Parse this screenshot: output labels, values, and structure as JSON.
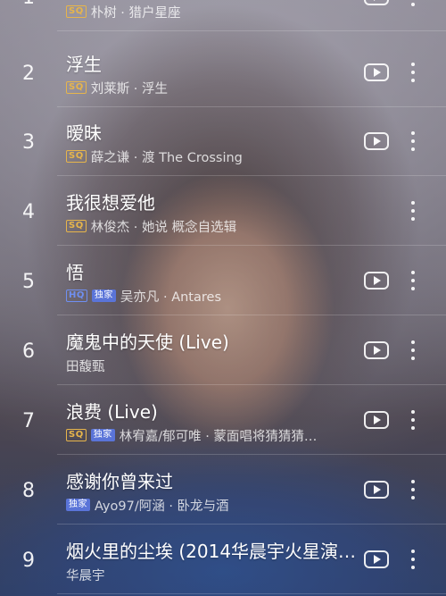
{
  "songs": [
    {
      "index": "1",
      "title": "",
      "badges": [
        "SQ"
      ],
      "subtitle": "朴树 · 猎户星座",
      "has_mv": true
    },
    {
      "index": "2",
      "title": "浮生",
      "badges": [
        "SQ"
      ],
      "subtitle": "刘莱斯 · 浮生",
      "has_mv": true
    },
    {
      "index": "3",
      "title": "暧昧",
      "badges": [
        "SQ"
      ],
      "subtitle": "薛之谦 · 渡 The Crossing",
      "has_mv": true
    },
    {
      "index": "4",
      "title": "我很想爱他",
      "badges": [
        "SQ"
      ],
      "subtitle": "林俊杰 · 她说 概念自选辑",
      "has_mv": false
    },
    {
      "index": "5",
      "title": "悟",
      "badges": [
        "HQ",
        "独家"
      ],
      "subtitle": "吴亦凡 · Antares",
      "has_mv": true
    },
    {
      "index": "6",
      "title": "魔鬼中的天使 (Live)",
      "badges": [],
      "subtitle": "田馥甄",
      "has_mv": true
    },
    {
      "index": "7",
      "title": "浪费 (Live)",
      "badges": [
        "SQ",
        "独家"
      ],
      "subtitle": "林宥嘉/郁可唯 · 蒙面唱将猜猜猜…",
      "has_mv": true
    },
    {
      "index": "8",
      "title": "感谢你曾来过",
      "badges": [
        "独家"
      ],
      "subtitle": "Ayo97/阿涵 · 卧龙与酒",
      "has_mv": true
    },
    {
      "index": "9",
      "title": "烟火里的尘埃 (2014华晨宇火星演…",
      "badges": [],
      "subtitle": "华晨宇",
      "has_mv": true
    }
  ],
  "icons": {
    "mv": "play-video-icon",
    "more": "more-vertical-icon"
  },
  "colors": {
    "sq_badge": "#e7b54b",
    "hq_badge": "#6f8ff2",
    "exclusive_badge": "#5a74d8"
  }
}
